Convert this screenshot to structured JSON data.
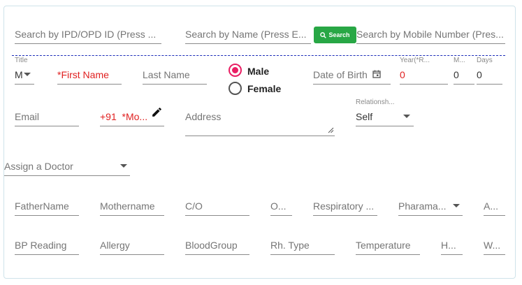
{
  "search": {
    "ipd_placeholder": "Search by IPD/OPD ID (Press ...",
    "name_placeholder": "Search by Name (Press E...",
    "button_label": "Search",
    "mobile_placeholder": "Search by Mobile Number (Pres..."
  },
  "patient": {
    "title_label": "Title",
    "title_value": "M",
    "first_name": "*First Name",
    "last_name": "Last Name",
    "gender_options": [
      "Male",
      "Female"
    ],
    "gender_selected": "Male",
    "dob": "Date of Birth",
    "year_label": "Year(*R...",
    "year_value": "0",
    "month_label": "M...",
    "month_value": "0",
    "days_label": "Days",
    "days_value": "0"
  },
  "contact": {
    "email": "Email",
    "phone_prefix": "+91",
    "mobile": "*Mo...",
    "address": "Address",
    "relationship_label": "Relationsh...",
    "relationship_value": "Self"
  },
  "doctor": {
    "assign_placeholder": "Assign a Doctor"
  },
  "details_row1": {
    "father": "FatherName",
    "mother": "Mothername",
    "co": "C/O",
    "o": "O...",
    "respiratory": "Respiratory ...",
    "pharmacy": "Pharama...",
    "a": "A..."
  },
  "details_row2": {
    "bp": "BP Reading",
    "allergy": "Allergy",
    "blood": "BloodGroup",
    "rh": "Rh. Type",
    "temperature": "Temperature",
    "h": "H...",
    "w": "W..."
  },
  "colors": {
    "accent_pink": "#e91e63",
    "required_red": "#e02020",
    "search_green": "#28a745",
    "divider_blue": "#1a2bb8"
  }
}
